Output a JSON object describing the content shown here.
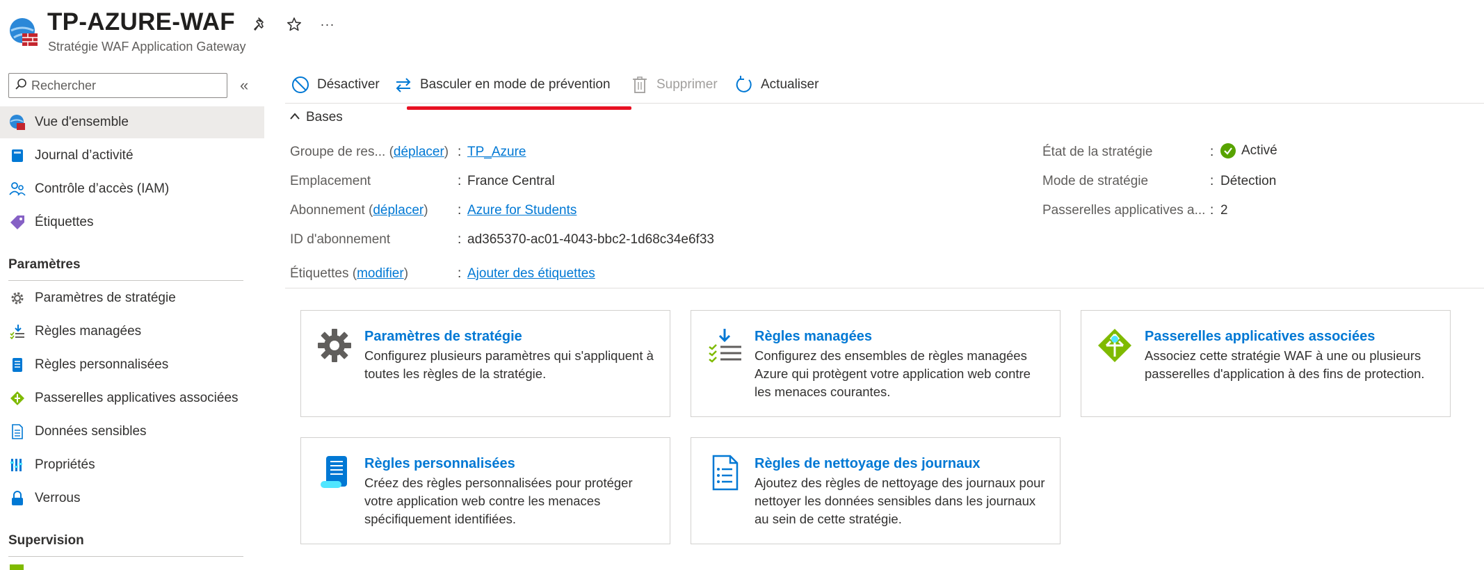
{
  "header": {
    "title": "TP-AZURE-WAF",
    "subtitle": "Stratégie WAF Application Gateway",
    "pin_icon": "pin-icon",
    "favorite_icon": "star-icon",
    "more_label": "···"
  },
  "sidebar": {
    "search_placeholder": "Rechercher",
    "collapse_label": "«",
    "items": [
      {
        "label": "Vue d'ensemble",
        "icon": "overview-icon",
        "active": true
      },
      {
        "label": "Journal d’activité",
        "icon": "activity-log-icon"
      },
      {
        "label": "Contrôle d’accès (IAM)",
        "icon": "iam-icon"
      },
      {
        "label": "Étiquettes",
        "icon": "tag-icon"
      }
    ],
    "sections": [
      {
        "title": "Paramètres",
        "items": [
          {
            "label": "Paramètres de stratégie",
            "icon": "gear-icon"
          },
          {
            "label": "Règles managées",
            "icon": "managed-rules-icon"
          },
          {
            "label": "Règles personnalisées",
            "icon": "custom-rules-icon"
          },
          {
            "label": "Passerelles applicatives associées",
            "icon": "app-gateway-icon"
          },
          {
            "label": "Données sensibles",
            "icon": "sensitive-data-icon"
          },
          {
            "label": "Propriétés",
            "icon": "properties-icon"
          },
          {
            "label": "Verrous",
            "icon": "lock-icon"
          }
        ]
      },
      {
        "title": "Supervision",
        "items": []
      }
    ]
  },
  "toolbar": {
    "disable_label": "Désactiver",
    "switch_label": "Basculer en mode de prévention",
    "delete_label": "Supprimer",
    "refresh_label": "Actualiser"
  },
  "essentials": {
    "section_label": "Bases",
    "left": [
      {
        "label": "Groupe de res...",
        "link_label": "déplacer",
        "value": "TP_Azure",
        "value_is_link": true
      },
      {
        "label": "Emplacement",
        "value": "France Central"
      },
      {
        "label": "Abonnement",
        "link_label": "déplacer",
        "value": "Azure for Students",
        "value_is_link": true
      },
      {
        "label": "ID d'abonnement",
        "value": "ad365370-ac01-4043-bbc2-1d68c34e6f33"
      },
      {
        "label": "Étiquettes",
        "link_label": "modifier",
        "value": "Ajouter des étiquettes",
        "value_is_link": true
      }
    ],
    "right": [
      {
        "label": "État de la stratégie",
        "value": "Activé",
        "status_color": "#57a300"
      },
      {
        "label": "Mode de stratégie",
        "value": "Détection"
      },
      {
        "label": "Passerelles applicatives a...",
        "value": "2"
      }
    ]
  },
  "cards": [
    {
      "title": "Paramètres de stratégie",
      "desc": "Configurez plusieurs paramètres qui s'appliquent à toutes les règles de la stratégie.",
      "icon": "gear-icon"
    },
    {
      "title": "Règles managées",
      "desc": "Configurez des ensembles de règles managées Azure qui protègent votre application web contre les menaces courantes.",
      "icon": "managed-rules-icon"
    },
    {
      "title": "Passerelles applicatives associées",
      "desc": "Associez cette stratégie WAF à une ou plusieurs passerelles d'application à des fins de protection.",
      "icon": "app-gateway-icon"
    },
    {
      "title": "Règles personnalisées",
      "desc": "Créez des règles personnalisées pour protéger votre application web contre les menaces spécifiquement identifiées.",
      "icon": "custom-rules-icon"
    },
    {
      "title": "Règles de nettoyage des journaux",
      "desc": "Ajoutez des règles de nettoyage des journaux pour nettoyer les données sensibles dans les journaux au sein de cette stratégie.",
      "icon": "log-scrubbing-icon"
    }
  ],
  "colors": {
    "accent": "#0078d4",
    "highlight_underline": "#e81123",
    "active_nav_bg": "#edebe9",
    "status_green": "#57a300"
  }
}
